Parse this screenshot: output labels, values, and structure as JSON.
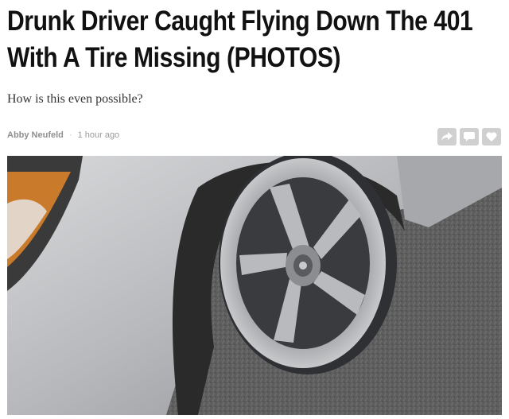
{
  "article": {
    "headline_line1": "Drunk Driver Caught Flying Down The 401",
    "headline_line2": "With A Tire Missing (PHOTOS)",
    "subheadline": "How is this even possible?",
    "author": "Abby Neufeld",
    "separator": "·",
    "timestamp": "1 hour ago"
  },
  "share": {
    "buttons": [
      {
        "icon": "share-arrow-icon"
      },
      {
        "icon": "comment-icon"
      },
      {
        "icon": "heart-icon"
      }
    ],
    "button_color": "#d0d0d0"
  },
  "hero_image": {
    "subject": "car-wheel-rim-without-tire"
  },
  "colors": {
    "headline": "#111111",
    "meta": "#9a9a9a"
  }
}
